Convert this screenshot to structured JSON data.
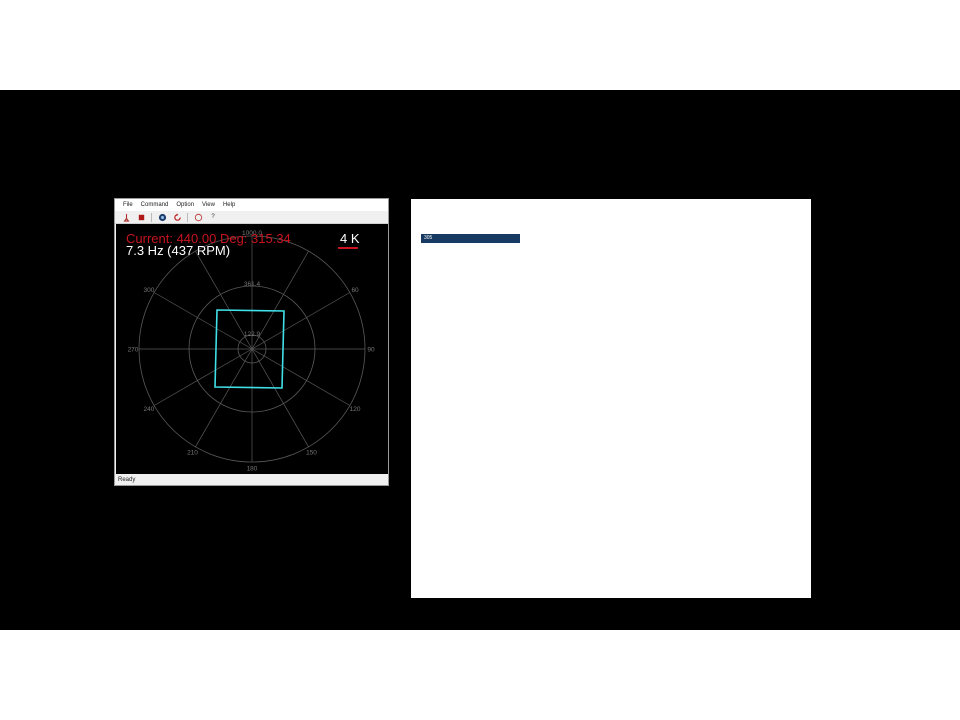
{
  "menu": [
    "File",
    "Command",
    "Option",
    "View",
    "Help"
  ],
  "toolbar": {
    "icons": [
      "antenna-icon",
      "stop-icon",
      "sensor-icon",
      "refresh-icon",
      "circle-icon"
    ],
    "help_label": "?"
  },
  "readout": {
    "current_text": "Current: 440.00 Deg: 315.34",
    "frequency_text": "7.3 Hz (437 RPM)",
    "resolution_text": "4 K"
  },
  "polar": {
    "radial_labels": [
      "1000.0",
      "361.4",
      "122.9"
    ],
    "angle_labels": [
      "0",
      "60",
      "90",
      "120",
      "150",
      "180",
      "210",
      "240",
      "270",
      "300"
    ],
    "trace_color": "#40e0e8",
    "grid_color": "#5a5a5a"
  },
  "status_bar": {
    "text": "Ready"
  },
  "side_panel": {
    "bar_text": "305"
  },
  "colors": {
    "alert": "#c8141e",
    "panel_bar": "#163a62"
  }
}
